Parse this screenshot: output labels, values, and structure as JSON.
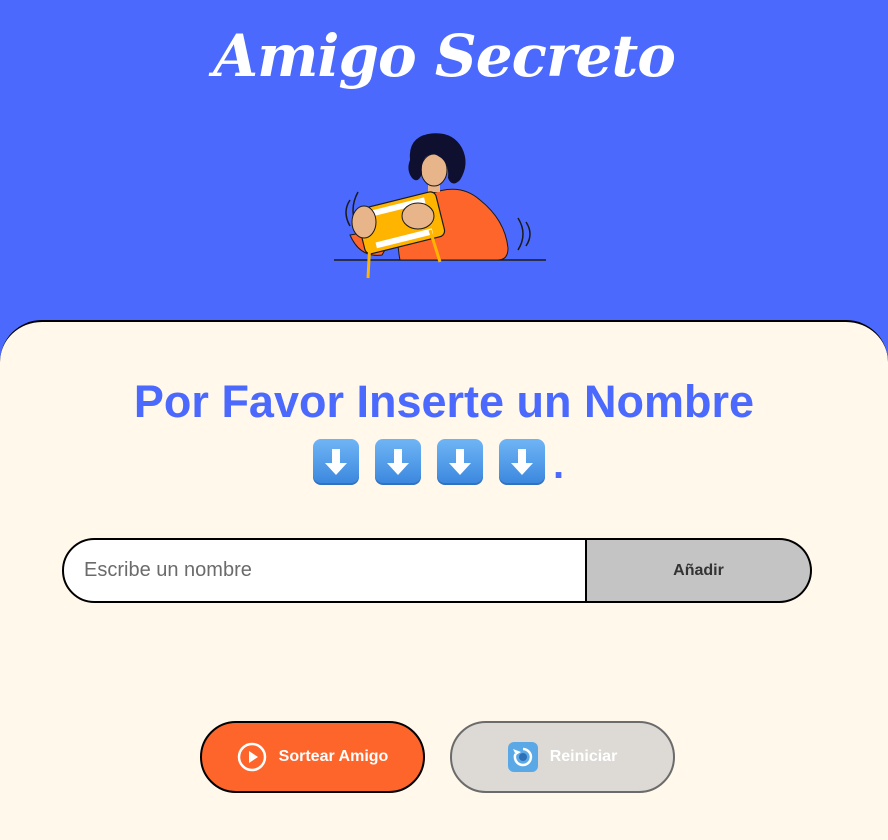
{
  "app": {
    "title": "Amigo Secreto"
  },
  "header": {
    "illustration": "person-playing-handheld-console"
  },
  "main": {
    "section_title": "Por Favor Inserte un Nombre",
    "arrow_icons": [
      "arrow-down-icon",
      "arrow-down-icon",
      "arrow-down-icon",
      "arrow-down-icon"
    ],
    "arrow_suffix": "."
  },
  "form": {
    "input_placeholder": "Escribe un nombre",
    "input_value": "",
    "add_label": "Añadir"
  },
  "actions": {
    "draw_label": "Sortear Amigo",
    "draw_icon": "play-circle-icon",
    "reset_label": "Reiniciar",
    "reset_icon": "restart-icon"
  },
  "colors": {
    "header_bg": "#4B69FD",
    "panel_bg": "#FFF8EB",
    "accent_title": "#4B69FD",
    "draw_button_bg": "#FE652B",
    "reset_button_bg": "#DDDAD6",
    "add_button_bg": "#C4C4C4"
  }
}
